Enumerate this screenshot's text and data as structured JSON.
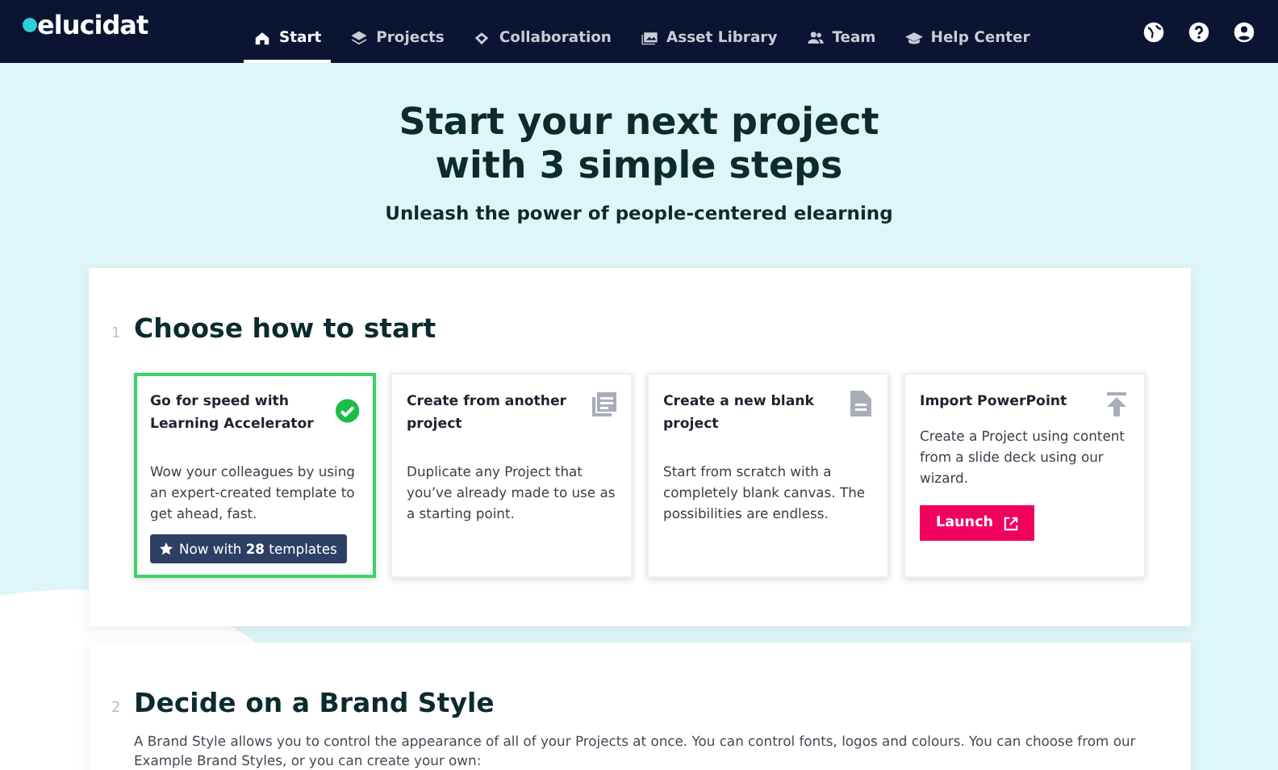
{
  "brand": "elucidat",
  "nav": [
    {
      "label": "Start",
      "selected": true
    },
    {
      "label": "Projects",
      "selected": false
    },
    {
      "label": "Collaboration",
      "selected": false
    },
    {
      "label": "Asset Library",
      "selected": false
    },
    {
      "label": "Team",
      "selected": false
    },
    {
      "label": "Help Center",
      "selected": false
    }
  ],
  "hero": {
    "title": "Start your next project with 3 simple steps",
    "subtitle": "Unleash the power of people-centered elearning"
  },
  "steps": [
    {
      "number": "1",
      "title": "Choose how to start",
      "options": [
        {
          "title": "Go for speed with Learning Accelerator",
          "text": "Wow your colleagues by using an expert-created template to get ahead, fast.",
          "selected": true,
          "badge": "Now with **28** templates"
        },
        {
          "title": "Create from another project",
          "text": "Duplicate any Project that you’ve already made to use as a starting point.",
          "selected": false
        },
        {
          "title": "Create a new blank project",
          "text": "Start from scratch with a completely blank canvas. The possibilities are endless.",
          "selected": false
        },
        {
          "title": "Import PowerPoint",
          "text": "Create a Project using content from a slide deck using our wizard.",
          "selected": false,
          "button": "Launch"
        }
      ]
    },
    {
      "number": "2",
      "title": "Decide on a Brand Style",
      "text": "A Brand Style allows you to control the appearance of all of your Projects at once. You can control fonts, logos and colours. You can choose from our Example Brand Styles, or you can create your own:"
    }
  ]
}
